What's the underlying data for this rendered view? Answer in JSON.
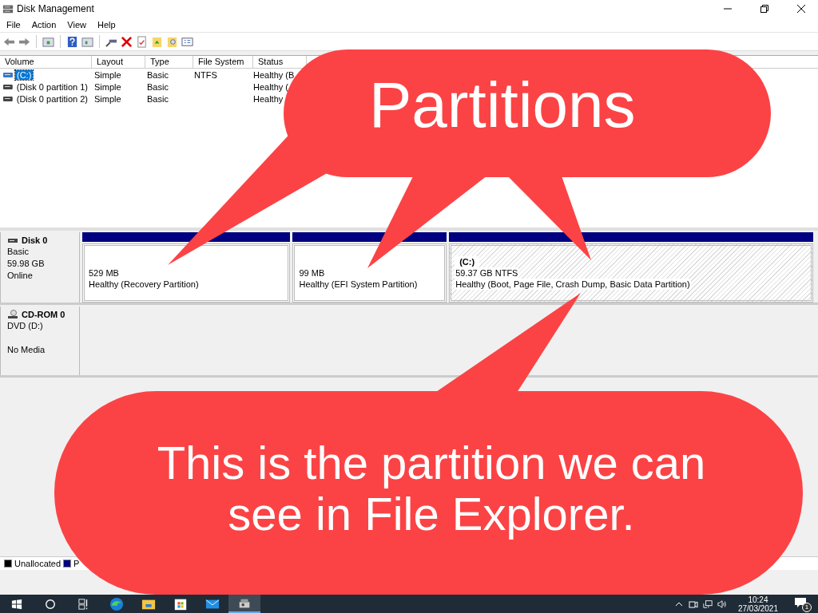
{
  "window": {
    "title": "Disk Management"
  },
  "menu": [
    "File",
    "Action",
    "View",
    "Help"
  ],
  "volume_list": {
    "columns": [
      "Volume",
      "Layout",
      "Type",
      "File System",
      "Status"
    ],
    "rows": [
      {
        "selected": true,
        "cells": [
          "(C:)",
          "Simple",
          "Basic",
          "NTFS",
          "Healthy (B"
        ]
      },
      {
        "selected": false,
        "cells": [
          "(Disk 0 partition 1)",
          "Simple",
          "Basic",
          "",
          "Healthy ("
        ]
      },
      {
        "selected": false,
        "cells": [
          "(Disk 0 partition 2)",
          "Simple",
          "Basic",
          "",
          "Healthy"
        ]
      }
    ]
  },
  "disks": [
    {
      "kind": "disk",
      "name": "Disk 0",
      "lines": [
        "Basic",
        "59.98 GB",
        "Online"
      ],
      "partitions": [
        {
          "size": "529 MB",
          "status": "Healthy (Recovery Partition)",
          "hatched": false
        },
        {
          "size": "99 MB",
          "status": "Healthy (EFI System Partition)",
          "hatched": false
        },
        {
          "label": "(C:)",
          "size": "59.37 GB NTFS",
          "status": "Healthy (Boot, Page File, Crash Dump, Basic Data Partition)",
          "hatched": true
        }
      ]
    },
    {
      "kind": "cdrom",
      "name": "CD-ROM 0",
      "lines": [
        "DVD (D:)"
      ],
      "media": "No Media"
    }
  ],
  "legend": [
    {
      "label": "Unallocated",
      "color": "#000000"
    },
    {
      "label": "P",
      "color": "#000080"
    }
  ],
  "callouts": [
    {
      "text": "Partitions"
    },
    {
      "text": "This is the partition we can see in File Explorer."
    }
  ],
  "taskbar": {
    "apps": [
      {
        "kind": "edge",
        "active": false
      },
      {
        "kind": "explorer",
        "active": false
      },
      {
        "kind": "store",
        "active": false
      },
      {
        "kind": "mail",
        "active": false
      },
      {
        "kind": "diskmgmt",
        "active": true
      }
    ],
    "time": "10:24",
    "date": "27/03/2021",
    "notifications": "1"
  }
}
